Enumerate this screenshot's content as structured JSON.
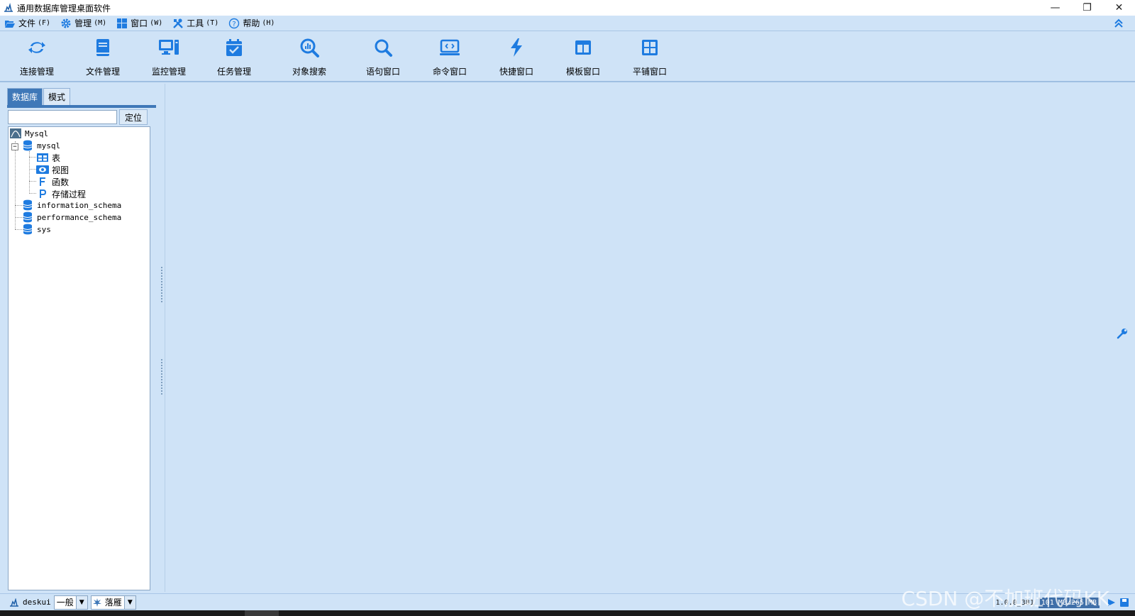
{
  "window": {
    "title": "通用数据库管理桌面软件",
    "controls": [
      "—",
      "❐",
      "✕"
    ]
  },
  "menu": [
    {
      "label": "文件",
      "accel": "(F)",
      "icon": "folder-open-icon"
    },
    {
      "label": "管理",
      "accel": "(M)",
      "icon": "gear-icon"
    },
    {
      "label": "窗口",
      "accel": "(W)",
      "icon": "windows-icon"
    },
    {
      "label": "工具",
      "accel": "(T)",
      "icon": "tools-icon"
    },
    {
      "label": "帮助",
      "accel": "(H)",
      "icon": "help-icon"
    }
  ],
  "toolbar": [
    {
      "label": "连接管理",
      "icon": "connection-icon"
    },
    {
      "label": "文件管理",
      "icon": "file-book-icon"
    },
    {
      "label": "监控管理",
      "icon": "monitor-icon"
    },
    {
      "label": "任务管理",
      "icon": "calendar-check-icon"
    },
    {
      "label": "对象搜索",
      "icon": "object-search-icon"
    },
    {
      "label": "语句窗口",
      "icon": "search-icon"
    },
    {
      "label": "命令窗口",
      "icon": "command-window-icon"
    },
    {
      "label": "快捷窗口",
      "icon": "lightning-icon"
    },
    {
      "label": "模板窗口",
      "icon": "template-icon"
    },
    {
      "label": "平铺窗口",
      "icon": "tile-icon"
    }
  ],
  "left_panel": {
    "tabs": [
      "数据库",
      "模式"
    ],
    "active_tab": "数据库",
    "search": {
      "value": "",
      "placeholder": ""
    },
    "locate_button": "定位",
    "tree": {
      "root": "Mysql",
      "databases": [
        {
          "name": "mysql",
          "expanded": true,
          "children": [
            "表",
            "视图",
            "函数",
            "存储过程"
          ]
        },
        {
          "name": "information_schema",
          "expanded": false
        },
        {
          "name": "performance_schema",
          "expanded": false
        },
        {
          "name": "sys",
          "expanded": false
        }
      ]
    }
  },
  "status": {
    "user": "deskui",
    "mode": "一般",
    "theme": "落雁",
    "version": "1.0.0_381",
    "memory": "101 MB/265 MB"
  },
  "watermark": "CSDN @不加班代码KK",
  "colors": {
    "background": "#cfe3f7",
    "accent": "#1e7be0",
    "active_tab": "#3f78b8"
  }
}
